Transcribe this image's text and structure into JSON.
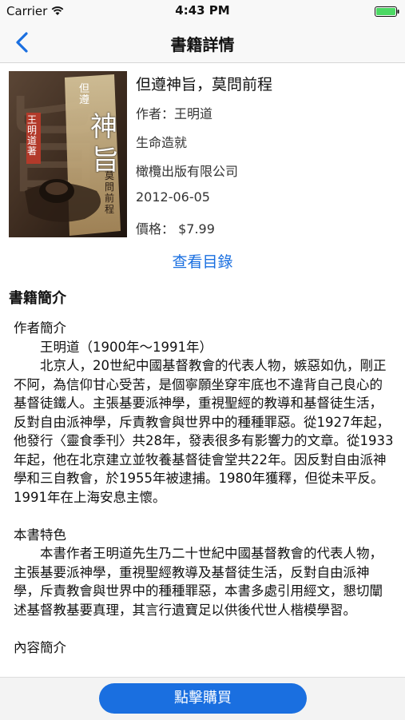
{
  "status_bar": {
    "carrier": "Carrier",
    "time": "4:43 PM"
  },
  "nav": {
    "title": "書籍詳情",
    "back_icon": "chevron-left-icon"
  },
  "book": {
    "title": "但遵神旨，莫問前程",
    "author": "作者：王明道",
    "series": "生命造就",
    "publisher": "橄欖出版有限公司",
    "date": "2012-06-05",
    "price": "價格： $7.99",
    "cover": {
      "title_chars": [
        "但遵",
        "神",
        "旨",
        "莫問前程"
      ],
      "author_label": "王明道 著"
    }
  },
  "toc_link": "查看目錄",
  "section_title": "書籍簡介",
  "description": {
    "author_heading": "作者簡介",
    "author_name_line": "王明道（1900年～1991年）",
    "author_bio": "北京人，20世紀中國基督教會的代表人物，嫉惡如仇，剛正不阿，為信仰甘心受苦，是個寧願坐穿牢底也不違背自己良心的基督徒鐵人。主張基要派神學，重視聖經的教導和基督徒生活，反對自由派神學，斥責教會與世界中的種種罪惡。從1927年起，他發行〈靈食季刊〉共28年，發表很多有影響力的文章。從1933年起，他在北京建立並牧養基督徒會堂共22年。因反對自由派神學和三自教會，於1955年被逮捕。1980年獲釋，但從未平反。1991年在上海安息主懷。",
    "features_heading": "本書特色",
    "features_text": "本書作者王明道先生乃二十世紀中國基督教會的代表人物，主張基要派神學，重視聖經教導及基督徒生活，反對自由派神學，斥責教會與世界中的種種罪惡，本書多處引用經文，懇切闡述基督教基要真理，其言行遺寶足以供後代世人楷模學習。",
    "content_heading": "內容簡介"
  },
  "buy_button": "點擊購買",
  "colors": {
    "accent": "#1a6fe0",
    "battery": "#4cd964"
  }
}
